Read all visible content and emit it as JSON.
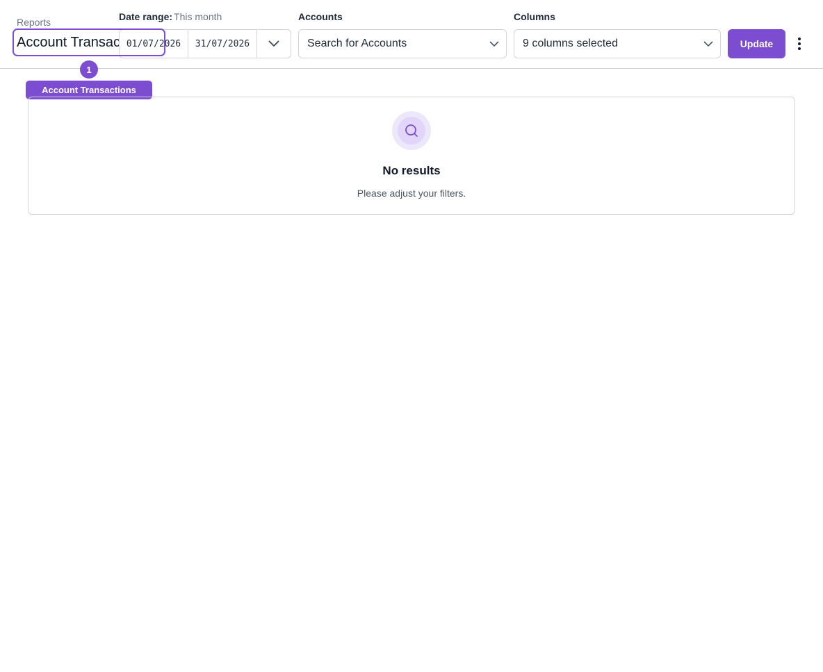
{
  "header": {
    "breadcrumb": "Reports",
    "title": "Account Transactions"
  },
  "filters": {
    "date_range": {
      "label": "Date range:",
      "preset": "This month",
      "start": "01/07/2026",
      "end": "31/07/2026",
      "toggle_icon": "chevron-down-icon"
    },
    "accounts": {
      "label": "Accounts",
      "placeholder": "Search for Accounts",
      "icon": "chevron-down-icon"
    },
    "columns": {
      "label": "Columns",
      "value": "9 columns selected",
      "icon": "chevron-down-icon"
    },
    "update_label": "Update",
    "more_icon": "vertical-ellipsis-icon"
  },
  "annotation": {
    "marker_number": "1",
    "tag_label": "Account Transactions"
  },
  "empty_state": {
    "icon": "search-icon",
    "title": "No results",
    "subtitle": "Please adjust your filters."
  },
  "colors": {
    "accent": "#7c4dd1",
    "border": "#d1d5db",
    "muted_text": "#6b7280"
  }
}
